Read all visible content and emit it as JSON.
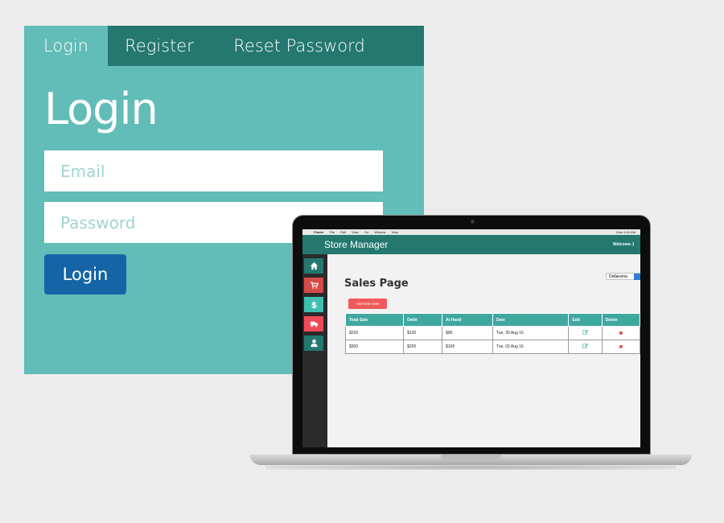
{
  "login": {
    "tabs": [
      {
        "label": "Login",
        "active": true
      },
      {
        "label": "Register",
        "active": false
      },
      {
        "label": "Reset Password",
        "active": false
      }
    ],
    "heading": "Login",
    "email_placeholder": "Email",
    "password_placeholder": "Password",
    "submit_label": "Login",
    "colors": {
      "panel": "#62bcb8",
      "tabbar": "#24786f",
      "button": "#1565a6"
    }
  },
  "laptop": {
    "menubar": {
      "apple": "",
      "items": [
        "Finder",
        "File",
        "Edit",
        "View",
        "Go",
        "Window",
        "Help"
      ],
      "clock": "Mon 9:41 AM"
    },
    "app": {
      "title": "Store Manager",
      "welcome": "Welcome J",
      "store_select": "Dollarama",
      "nav_icons": [
        "home-icon",
        "cart-icon",
        "dollar-icon",
        "truck-icon",
        "user-icon"
      ],
      "page_title": "Sales Page",
      "add_button": "Add New Sale",
      "table": {
        "headers": [
          "Total Sale",
          "Debit",
          "At Hand",
          "Date",
          "Edit",
          "Delete"
        ],
        "rows": [
          {
            "total": "$220",
            "debit": "$130",
            "at_hand": "$90",
            "date": "Tue, 30 Aug 16",
            "delete": "✖"
          },
          {
            "total": "$300",
            "debit": "$200",
            "at_hand": "$100",
            "date": "Tue, 02 Aug 16",
            "delete": "✖"
          }
        ]
      },
      "colors": {
        "header": "#24786f",
        "table_header": "#3fa89f",
        "add_button": "#f05a5a"
      }
    }
  }
}
